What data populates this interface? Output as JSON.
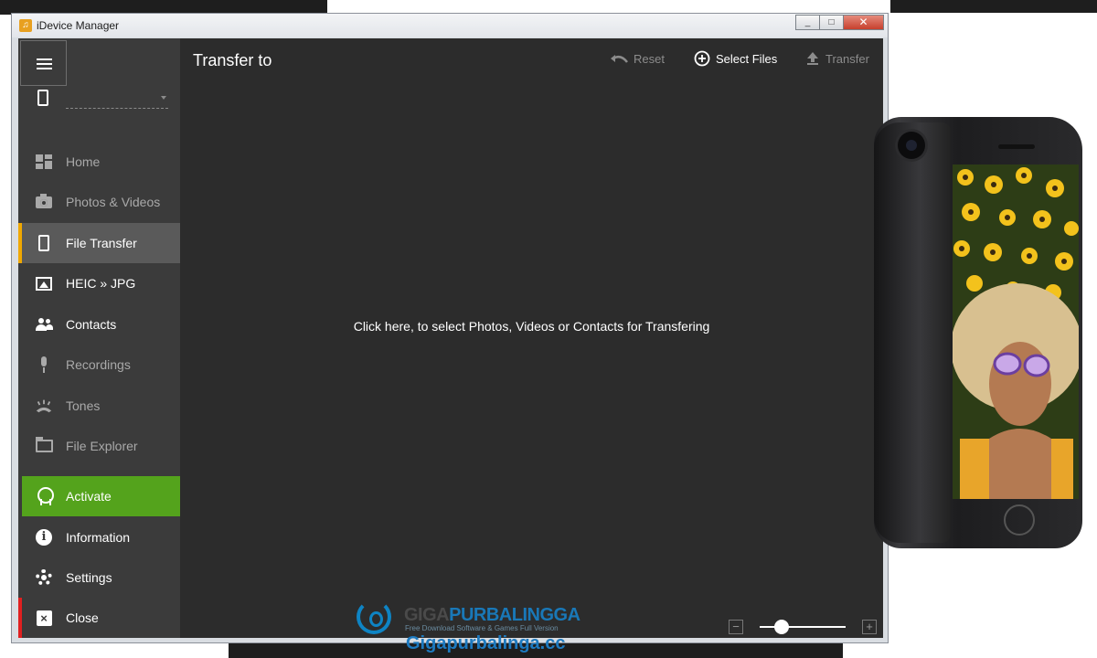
{
  "window": {
    "title": "iDevice Manager",
    "controls": {
      "minimize": "_",
      "maximize": "□",
      "close": "✕"
    }
  },
  "sidebar": {
    "items": [
      {
        "id": "home",
        "label": "Home",
        "icon": "home-grid-icon",
        "state": "dim"
      },
      {
        "id": "photos",
        "label": "Photos & Videos",
        "icon": "camera-icon",
        "state": "dim"
      },
      {
        "id": "file-transfer",
        "label": "File Transfer",
        "icon": "phone-icon",
        "state": "active"
      },
      {
        "id": "heic",
        "label": "HEIC » JPG",
        "icon": "picture-icon",
        "state": "bright"
      },
      {
        "id": "contacts",
        "label": "Contacts",
        "icon": "people-icon",
        "state": "bright"
      },
      {
        "id": "recordings",
        "label": "Recordings",
        "icon": "microphone-icon",
        "state": "dim"
      },
      {
        "id": "tones",
        "label": "Tones",
        "icon": "ringtone-icon",
        "state": "dim"
      },
      {
        "id": "file-explorer",
        "label": "File Explorer",
        "icon": "folder-icon",
        "state": "dim"
      }
    ],
    "bottom_items": [
      {
        "id": "activate",
        "label": "Activate",
        "icon": "badge-icon"
      },
      {
        "id": "information",
        "label": "Information",
        "icon": "info-icon"
      },
      {
        "id": "settings",
        "label": "Settings",
        "icon": "gear-icon"
      },
      {
        "id": "close",
        "label": "Close",
        "icon": "close-icon"
      }
    ]
  },
  "main": {
    "title": "Transfer to",
    "toolbar": {
      "reset_label": "Reset",
      "select_files_label": "Select Files",
      "transfer_label": "Transfer"
    },
    "hint": "Click here, to select Photos, Videos or Contacts for Transfering",
    "zoom": {
      "minus": "−",
      "plus": "+",
      "level": 0.25
    }
  },
  "watermark": {
    "brand_part1": "GIGA",
    "brand_part2": "PURBALINGGA",
    "tagline": "Free Download Software & Games Full Version",
    "url": "Gigapurbalinga.cc"
  },
  "colors": {
    "sidebar_bg": "#3b3b3b",
    "main_bg": "#2c2c2c",
    "active_accent": "#f0a800",
    "activate_green": "#54a31c",
    "close_accent": "#e02020"
  }
}
